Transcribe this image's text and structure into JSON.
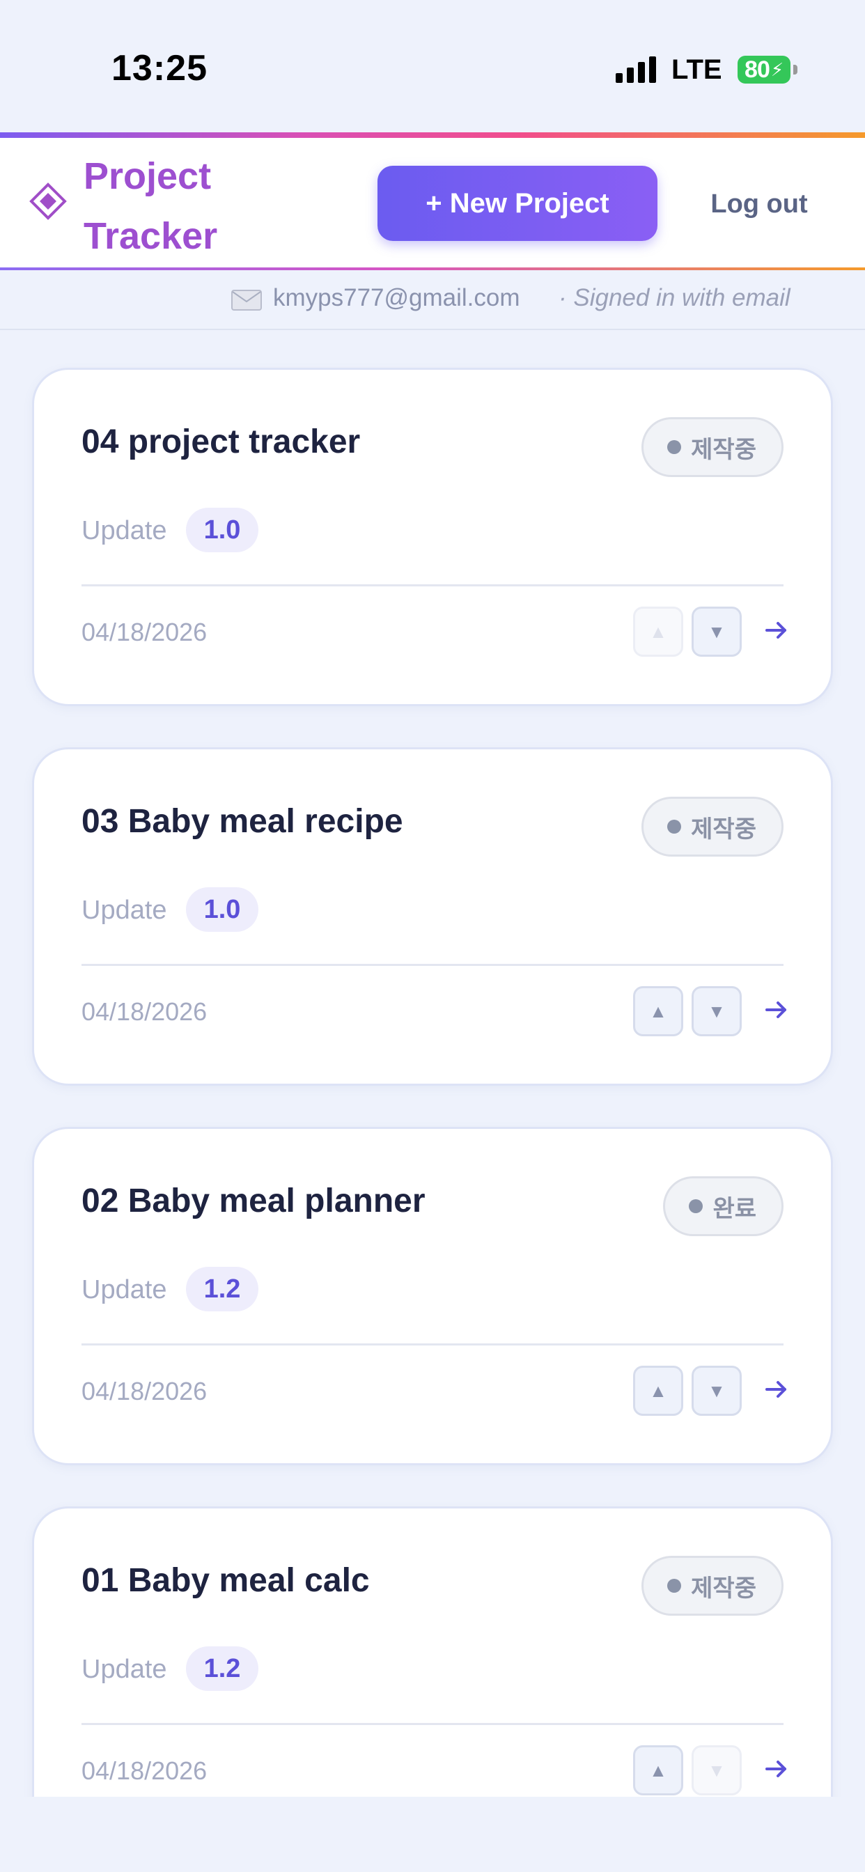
{
  "status_bar": {
    "time": "13:25",
    "network": "LTE",
    "battery": "80"
  },
  "header": {
    "brand_line1": "Project",
    "brand_line2": "Tracker",
    "new_project_label": "+ New Project",
    "logout_label": "Log out"
  },
  "account": {
    "email": "kmyps777@gmail.com",
    "signed_in_text": "· Signed in with email"
  },
  "labels": {
    "update": "Update"
  },
  "projects": [
    {
      "title": "04 project tracker",
      "status": "제작중",
      "version": "1.0",
      "date": "04/18/2026",
      "up_enabled": false,
      "down_enabled": true
    },
    {
      "title": "03 Baby meal recipe",
      "status": "제작중",
      "version": "1.0",
      "date": "04/18/2026",
      "up_enabled": true,
      "down_enabled": true
    },
    {
      "title": "02 Baby meal planner",
      "status": "완료",
      "version": "1.2",
      "date": "04/18/2026",
      "up_enabled": true,
      "down_enabled": true
    },
    {
      "title": "01 Baby meal calc",
      "status": "제작중",
      "version": "1.2",
      "date": "04/18/2026",
      "up_enabled": true,
      "down_enabled": false
    }
  ],
  "colors": {
    "accent": "#6b5cf0",
    "brand": "#9d4fd0",
    "background": "#eef2fc",
    "status_green": "#34c759"
  },
  "icons": {
    "logo": "diamond-icon",
    "email": "envelope-icon",
    "move_up": "triangle-up-icon",
    "move_down": "triangle-down-icon",
    "open": "arrow-right-icon"
  }
}
